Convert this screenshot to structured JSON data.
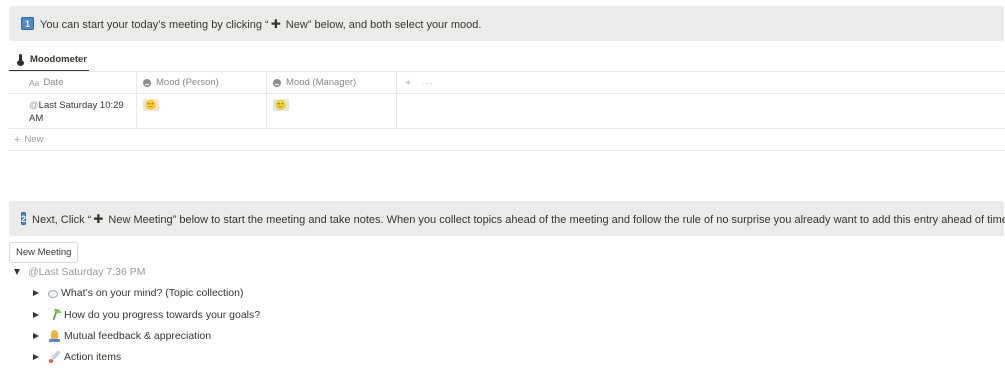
{
  "step1": {
    "number": "1",
    "prefix": "You can start your today’s meeting by clicking “",
    "plus": "✚",
    "suffix": " New” below, and both select your mood."
  },
  "database": {
    "tab_label": "Moodometer",
    "columns": [
      {
        "icon": "Aa",
        "label": "Date"
      },
      {
        "icon": "mood-icon",
        "label": "Mood (Person)"
      },
      {
        "icon": "mood-icon",
        "label": "Mood (Manager)"
      }
    ],
    "add_column": "+",
    "more": "···",
    "rows": [
      {
        "at": "@",
        "date": "Last Saturday 10:29 AM",
        "mood_person": "🙂",
        "mood_manager": "🙂"
      }
    ],
    "new_label": "New",
    "new_plus": "+"
  },
  "step2": {
    "number": "2",
    "prefix": "Next, Click “",
    "plus": "✚",
    "suffix": " New Meeting” below to start the meeting and take notes. When you collect topics ahead of the meeting and follow the rule of no surprise you already want to add this entry ahead of time."
  },
  "new_meeting_button": "New Meeting",
  "meeting": {
    "title": "@Last Saturday 7:36 PM",
    "items": [
      {
        "icon": "thought-bubble-icon",
        "label": "What’s on your mind? (Topic collection)"
      },
      {
        "icon": "seedling-icon",
        "label": "How do you progress towards your goals?"
      },
      {
        "icon": "folded-hands-icon",
        "label": "Mutual feedback & appreciation"
      },
      {
        "icon": "rocket-icon",
        "label": "Action items"
      }
    ]
  },
  "colors": {
    "callout_bg": "#ebebea",
    "number_badge": "#4f87c6",
    "text": "#37352f",
    "muted": "#9b9a97"
  }
}
